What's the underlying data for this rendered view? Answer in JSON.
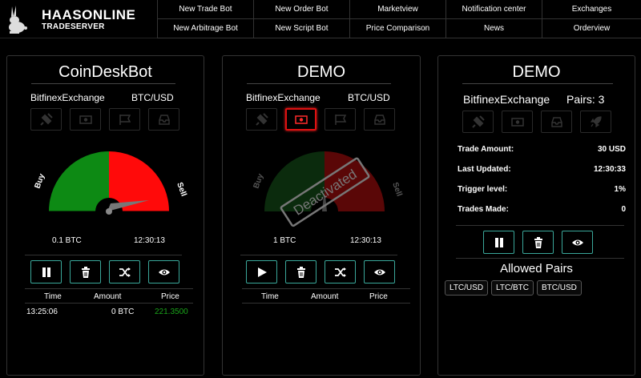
{
  "brand": {
    "title": "HAASONLINE",
    "subtitle": "TRADESERVER"
  },
  "nav": [
    "New Trade Bot",
    "New Order Bot",
    "Marketview",
    "Notification center",
    "Exchanges",
    "New Arbitrage Bot",
    "New Script Bot",
    "Price Comparison",
    "News",
    "Orderview"
  ],
  "panels": [
    {
      "name": "CoinDeskBot",
      "exchange": "BitfinexExchange",
      "pair": "BTC/USD",
      "icons": [
        "plug-icon",
        "money-icon",
        "flag-icon",
        "inbox-icon"
      ],
      "gauge": {
        "left_label": "Buy",
        "right_label": "Sell",
        "active": true
      },
      "amount": "0.1 BTC",
      "time": "12:30:13",
      "table_headers": [
        "Time",
        "Amount",
        "Price"
      ],
      "trades": [
        {
          "time": "13:25:06",
          "amount": "0 BTC",
          "price": "221.3500"
        }
      ]
    },
    {
      "name": "DEMO",
      "exchange": "BitfinexExchange",
      "pair": "BTC/USD",
      "icons": [
        "plug-icon",
        "money-icon",
        "flag-icon",
        "inbox-icon"
      ],
      "gauge": {
        "left_label": "Buy",
        "right_label": "Sell",
        "active": false,
        "stamp": "Deactivated"
      },
      "amount": "1 BTC",
      "time": "12:30:13",
      "table_headers": [
        "Time",
        "Amount",
        "Price"
      ],
      "trades": []
    },
    {
      "name": "DEMO",
      "exchange": "BitfinexExchange",
      "pairs_label": "Pairs: 3",
      "icons": [
        "plug-icon",
        "money-icon",
        "inbox-icon",
        "rocket-icon"
      ],
      "stats": [
        {
          "label": "Trade Amount:",
          "value": "30 USD"
        },
        {
          "label": "Last Updated:",
          "value": "12:30:33"
        },
        {
          "label": "Trigger level:",
          "value": "1%"
        },
        {
          "label": "Trades Made:",
          "value": "0"
        }
      ],
      "allowed_title": "Allowed Pairs",
      "allowed_pairs": [
        "LTC/USD",
        "LTC/BTC",
        "BTC/USD"
      ]
    }
  ],
  "colors": {
    "buy": "#0d8a14",
    "sell": "#ff0a0a",
    "buy_dim": "#0b2b0d",
    "sell_dim": "#5a0707",
    "accent": "#3aa79a",
    "price": "#1aa31a",
    "alert": "#d11111"
  }
}
